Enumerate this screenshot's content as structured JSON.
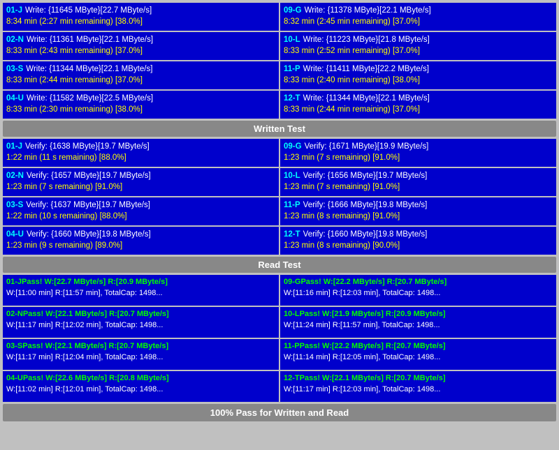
{
  "sections": {
    "write": {
      "header": "Written Test",
      "rows": [
        {
          "left": {
            "id": "01-J",
            "line1": "Write: {11645 MByte}[22.7 MByte/s]",
            "line2": "8:34 min (2:27 min remaining)  [38.0%]"
          },
          "right": {
            "id": "09-G",
            "line1": "Write: {11378 MByte}[22.1 MByte/s]",
            "line2": "8:32 min (2:45 min remaining)  [37.0%]"
          }
        },
        {
          "left": {
            "id": "02-N",
            "line1": "Write: {11361 MByte}[22.1 MByte/s]",
            "line2": "8:33 min (2:43 min remaining)  [37.0%]"
          },
          "right": {
            "id": "10-L",
            "line1": "Write: {11223 MByte}[21.8 MByte/s]",
            "line2": "8:33 min (2:52 min remaining)  [37.0%]"
          }
        },
        {
          "left": {
            "id": "03-S",
            "line1": "Write: {11344 MByte}[22.1 MByte/s]",
            "line2": "8:33 min (2:44 min remaining)  [37.0%]"
          },
          "right": {
            "id": "11-P",
            "line1": "Write: {11411 MByte}[22.2 MByte/s]",
            "line2": "8:33 min (2:40 min remaining)  [38.0%]"
          }
        },
        {
          "left": {
            "id": "04-U",
            "line1": "Write: {11582 MByte}[22.5 MByte/s]",
            "line2": "8:33 min (2:30 min remaining)  [38.0%]"
          },
          "right": {
            "id": "12-T",
            "line1": "Write: {11344 MByte}[22.1 MByte/s]",
            "line2": "8:33 min (2:44 min remaining)  [37.0%]"
          }
        }
      ]
    },
    "verify": {
      "rows": [
        {
          "left": {
            "id": "01-J",
            "line1": "Verify: {1638 MByte}[19.7 MByte/s]",
            "line2": "1:22 min (11 s remaining)  [88.0%]"
          },
          "right": {
            "id": "09-G",
            "line1": "Verify: {1671 MByte}[19.9 MByte/s]",
            "line2": "1:23 min (7 s remaining)  [91.0%]"
          }
        },
        {
          "left": {
            "id": "02-N",
            "line1": "Verify: {1657 MByte}[19.7 MByte/s]",
            "line2": "1:23 min (7 s remaining)  [91.0%]"
          },
          "right": {
            "id": "10-L",
            "line1": "Verify: {1656 MByte}[19.7 MByte/s]",
            "line2": "1:23 min (7 s remaining)  [91.0%]"
          }
        },
        {
          "left": {
            "id": "03-S",
            "line1": "Verify: {1637 MByte}[19.7 MByte/s]",
            "line2": "1:22 min (10 s remaining)  [88.0%]"
          },
          "right": {
            "id": "11-P",
            "line1": "Verify: {1666 MByte}[19.8 MByte/s]",
            "line2": "1:23 min (8 s remaining)  [91.0%]"
          }
        },
        {
          "left": {
            "id": "04-U",
            "line1": "Verify: {1660 MByte}[19.8 MByte/s]",
            "line2": "1:23 min (9 s remaining)  [89.0%]"
          },
          "right": {
            "id": "12-T",
            "line1": "Verify: {1660 MByte}[19.8 MByte/s]",
            "line2": "1:23 min (8 s remaining)  [90.0%]"
          }
        }
      ]
    },
    "read": {
      "header": "Read Test",
      "rows": [
        {
          "left": {
            "id": "01-J",
            "line1": "Pass! W:[22.7 MByte/s] R:[20.9 MByte/s]",
            "line2": " W:[11:00 min] R:[11:57 min], TotalCap: 1498..."
          },
          "right": {
            "id": "09-G",
            "line1": "Pass! W:[22.2 MByte/s] R:[20.7 MByte/s]",
            "line2": " W:[11:16 min] R:[12:03 min], TotalCap: 1498..."
          }
        },
        {
          "left": {
            "id": "02-N",
            "line1": "Pass! W:[22.1 MByte/s] R:[20.7 MByte/s]",
            "line2": " W:[11:17 min] R:[12:02 min], TotalCap: 1498..."
          },
          "right": {
            "id": "10-L",
            "line1": "Pass! W:[21.9 MByte/s] R:[20.9 MByte/s]",
            "line2": " W:[11:24 min] R:[11:57 min], TotalCap: 1498..."
          }
        },
        {
          "left": {
            "id": "03-S",
            "line1": "Pass! W:[22.1 MByte/s] R:[20.7 MByte/s]",
            "line2": " W:[11:17 min] R:[12:04 min], TotalCap: 1498..."
          },
          "right": {
            "id": "11-P",
            "line1": "Pass! W:[22.2 MByte/s] R:[20.7 MByte/s]",
            "line2": " W:[11:14 min] R:[12:05 min], TotalCap: 1498..."
          }
        },
        {
          "left": {
            "id": "04-U",
            "line1": "Pass! W:[22.6 MByte/s] R:[20.8 MByte/s]",
            "line2": " W:[11:02 min] R:[12:01 min], TotalCap: 1498..."
          },
          "right": {
            "id": "12-T",
            "line1": "Pass! W:[22.1 MByte/s] R:[20.7 MByte/s]",
            "line2": " W:[11:17 min] R:[12:03 min], TotalCap: 1498..."
          }
        }
      ]
    },
    "footer": "100% Pass for Written and Read"
  }
}
